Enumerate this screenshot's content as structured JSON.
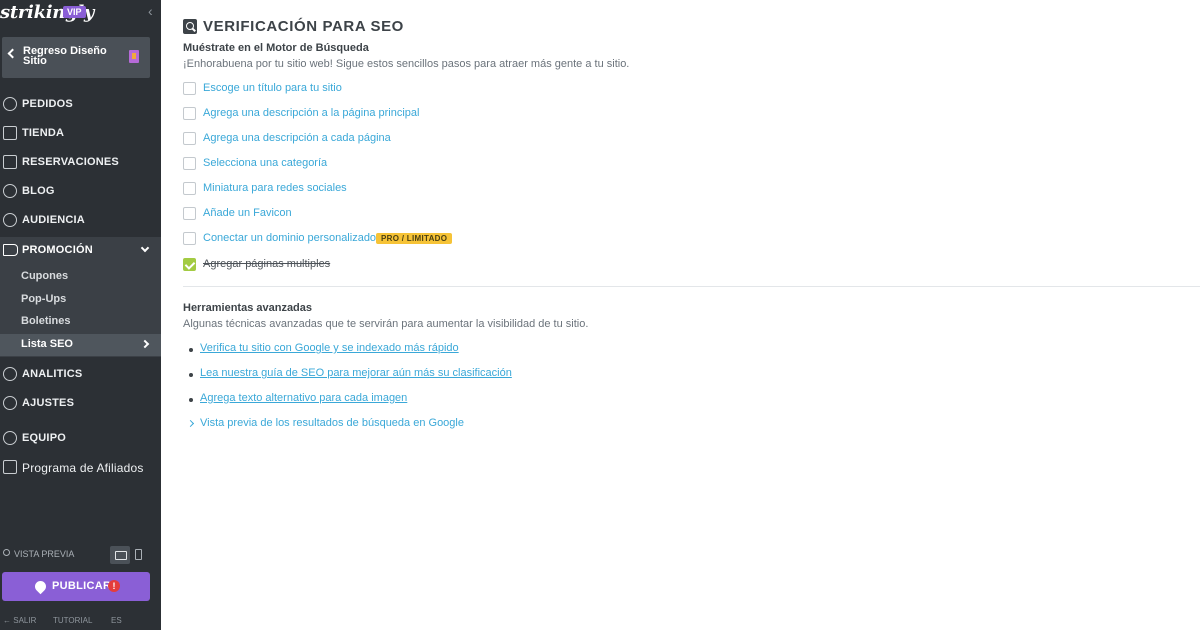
{
  "sidebar": {
    "logo": "strikingly",
    "vip_badge": "VIP",
    "collapse_glyph": "‹",
    "back_label": "Regreso Diseño Sitio",
    "nav_top": [
      {
        "label": "PEDIDOS",
        "icon": "dollar-circle-icon"
      },
      {
        "label": "TIENDA",
        "icon": "store-icon"
      },
      {
        "label": "RESERVACIONES",
        "icon": "calendar-icon"
      },
      {
        "label": "BLOG",
        "icon": "feather-icon"
      },
      {
        "label": "AUDIENCIA",
        "icon": "users-icon"
      }
    ],
    "promotion": {
      "label": "PROMOCIÓN",
      "icon": "megaphone-icon",
      "items": [
        "Cupones",
        "Pop-Ups",
        "Boletines",
        "Lista SEO"
      ]
    },
    "nav_bottom": [
      {
        "label": "ANALITICS",
        "icon": "pie-chart-icon"
      },
      {
        "label": "AJUSTES",
        "icon": "gear-icon"
      },
      {
        "label": "EQUIPO",
        "icon": "team-icon"
      },
      {
        "label": "Programa de Afiliados",
        "icon": "trophy-icon"
      }
    ],
    "preview_label": "VISTA PREVIA",
    "publish_label": "PUBLICAR",
    "publish_alert": "!",
    "footer": {
      "exit": "SALIR",
      "tutorial": "TUTORIAL",
      "lang": "ES"
    }
  },
  "main": {
    "title": "VERIFICACIÓN PARA SEO",
    "section1": {
      "title": "Muéstrate en el Motor de Búsqueda",
      "desc": "¡Enhorabuena por tu sitio web! Sigue estos sencillos pasos para atraer más gente a tu sitio.",
      "checklist": [
        {
          "label": "Escoge un título para tu sitio",
          "done": false
        },
        {
          "label": "Agrega una descripción a la página principal",
          "done": false
        },
        {
          "label": "Agrega una descripción a cada página",
          "done": false
        },
        {
          "label": "Selecciona una categoría",
          "done": false
        },
        {
          "label": "Miniatura para redes sociales",
          "done": false
        },
        {
          "label": "Añade un Favicon",
          "done": false
        },
        {
          "label": "Conectar un dominio personalizado",
          "done": false,
          "badge": "PRO / LIMITADO"
        },
        {
          "label": "Agregar páginas multiples",
          "done": true
        }
      ]
    },
    "section2": {
      "title": "Herramientas avanzadas",
      "desc": "Algunas técnicas avanzadas que te servirán para aumentar la visibilidad de tu sitio.",
      "links": [
        "Verifica tu sitio con Google y se indexado más rápido",
        "Lea nuestra guía de SEO para mejorar aún más su clasificación",
        "Agrega texto alternativo para cada imagen"
      ],
      "preview_link": "Vista previa de los resultados de búsqueda en Google"
    }
  },
  "colors": {
    "sidebar": "#2c3035",
    "accent": "#8a5fd6",
    "link": "#3aa8d8",
    "check": "#a3cb43",
    "badge": "#f6c337"
  }
}
